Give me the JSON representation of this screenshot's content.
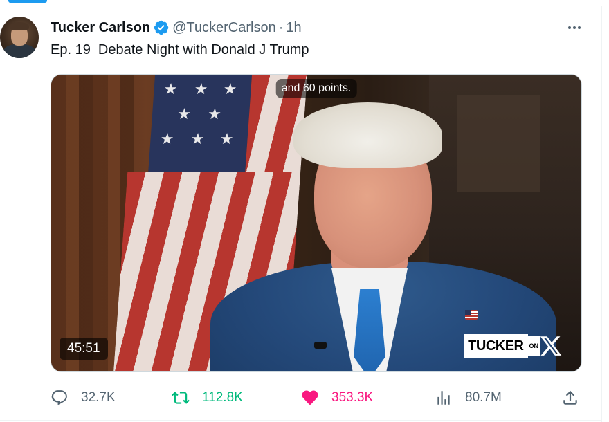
{
  "tweet": {
    "author_name": "Tucker Carlson",
    "handle": "@TuckerCarlson",
    "separator": "·",
    "time": "1h",
    "text": "Ep. 19  Debate Night with Donald J Trump",
    "verified": true
  },
  "media": {
    "caption": "and 60 points.",
    "duration": "45:51",
    "watermark_main": "TUCKER",
    "watermark_on": "ON",
    "watermark_x": "X"
  },
  "actions": {
    "replies": "32.7K",
    "retweets": "112.8K",
    "likes": "353.3K",
    "views": "80.7M"
  },
  "colors": {
    "accent": "#1d9bf0",
    "retweet": "#00ba7c",
    "like": "#f91880",
    "muted": "#536471"
  },
  "icons": [
    "verified-badge-icon",
    "more-icon",
    "reply-icon",
    "retweet-icon",
    "like-icon",
    "views-icon",
    "share-icon"
  ]
}
